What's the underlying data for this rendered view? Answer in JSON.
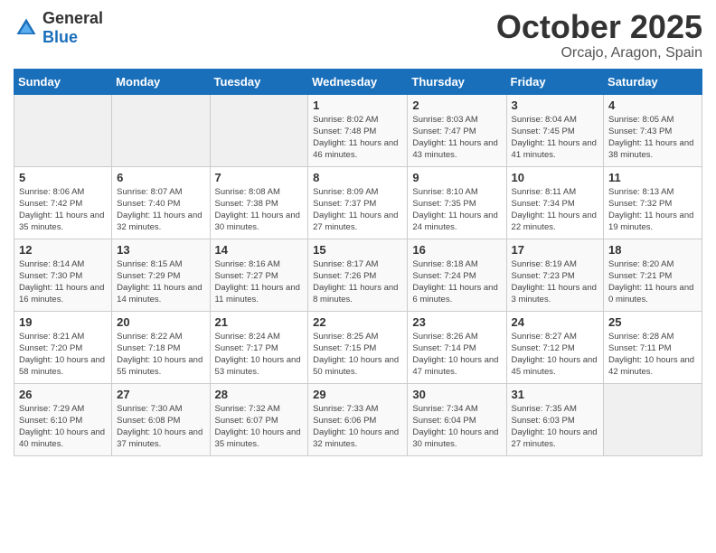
{
  "header": {
    "logo_general": "General",
    "logo_blue": "Blue",
    "month": "October 2025",
    "location": "Orcajo, Aragon, Spain"
  },
  "weekdays": [
    "Sunday",
    "Monday",
    "Tuesday",
    "Wednesday",
    "Thursday",
    "Friday",
    "Saturday"
  ],
  "weeks": [
    [
      {
        "day": "",
        "info": ""
      },
      {
        "day": "",
        "info": ""
      },
      {
        "day": "",
        "info": ""
      },
      {
        "day": "1",
        "info": "Sunrise: 8:02 AM\nSunset: 7:48 PM\nDaylight: 11 hours and 46 minutes."
      },
      {
        "day": "2",
        "info": "Sunrise: 8:03 AM\nSunset: 7:47 PM\nDaylight: 11 hours and 43 minutes."
      },
      {
        "day": "3",
        "info": "Sunrise: 8:04 AM\nSunset: 7:45 PM\nDaylight: 11 hours and 41 minutes."
      },
      {
        "day": "4",
        "info": "Sunrise: 8:05 AM\nSunset: 7:43 PM\nDaylight: 11 hours and 38 minutes."
      }
    ],
    [
      {
        "day": "5",
        "info": "Sunrise: 8:06 AM\nSunset: 7:42 PM\nDaylight: 11 hours and 35 minutes."
      },
      {
        "day": "6",
        "info": "Sunrise: 8:07 AM\nSunset: 7:40 PM\nDaylight: 11 hours and 32 minutes."
      },
      {
        "day": "7",
        "info": "Sunrise: 8:08 AM\nSunset: 7:38 PM\nDaylight: 11 hours and 30 minutes."
      },
      {
        "day": "8",
        "info": "Sunrise: 8:09 AM\nSunset: 7:37 PM\nDaylight: 11 hours and 27 minutes."
      },
      {
        "day": "9",
        "info": "Sunrise: 8:10 AM\nSunset: 7:35 PM\nDaylight: 11 hours and 24 minutes."
      },
      {
        "day": "10",
        "info": "Sunrise: 8:11 AM\nSunset: 7:34 PM\nDaylight: 11 hours and 22 minutes."
      },
      {
        "day": "11",
        "info": "Sunrise: 8:13 AM\nSunset: 7:32 PM\nDaylight: 11 hours and 19 minutes."
      }
    ],
    [
      {
        "day": "12",
        "info": "Sunrise: 8:14 AM\nSunset: 7:30 PM\nDaylight: 11 hours and 16 minutes."
      },
      {
        "day": "13",
        "info": "Sunrise: 8:15 AM\nSunset: 7:29 PM\nDaylight: 11 hours and 14 minutes."
      },
      {
        "day": "14",
        "info": "Sunrise: 8:16 AM\nSunset: 7:27 PM\nDaylight: 11 hours and 11 minutes."
      },
      {
        "day": "15",
        "info": "Sunrise: 8:17 AM\nSunset: 7:26 PM\nDaylight: 11 hours and 8 minutes."
      },
      {
        "day": "16",
        "info": "Sunrise: 8:18 AM\nSunset: 7:24 PM\nDaylight: 11 hours and 6 minutes."
      },
      {
        "day": "17",
        "info": "Sunrise: 8:19 AM\nSunset: 7:23 PM\nDaylight: 11 hours and 3 minutes."
      },
      {
        "day": "18",
        "info": "Sunrise: 8:20 AM\nSunset: 7:21 PM\nDaylight: 11 hours and 0 minutes."
      }
    ],
    [
      {
        "day": "19",
        "info": "Sunrise: 8:21 AM\nSunset: 7:20 PM\nDaylight: 10 hours and 58 minutes."
      },
      {
        "day": "20",
        "info": "Sunrise: 8:22 AM\nSunset: 7:18 PM\nDaylight: 10 hours and 55 minutes."
      },
      {
        "day": "21",
        "info": "Sunrise: 8:24 AM\nSunset: 7:17 PM\nDaylight: 10 hours and 53 minutes."
      },
      {
        "day": "22",
        "info": "Sunrise: 8:25 AM\nSunset: 7:15 PM\nDaylight: 10 hours and 50 minutes."
      },
      {
        "day": "23",
        "info": "Sunrise: 8:26 AM\nSunset: 7:14 PM\nDaylight: 10 hours and 47 minutes."
      },
      {
        "day": "24",
        "info": "Sunrise: 8:27 AM\nSunset: 7:12 PM\nDaylight: 10 hours and 45 minutes."
      },
      {
        "day": "25",
        "info": "Sunrise: 8:28 AM\nSunset: 7:11 PM\nDaylight: 10 hours and 42 minutes."
      }
    ],
    [
      {
        "day": "26",
        "info": "Sunrise: 7:29 AM\nSunset: 6:10 PM\nDaylight: 10 hours and 40 minutes."
      },
      {
        "day": "27",
        "info": "Sunrise: 7:30 AM\nSunset: 6:08 PM\nDaylight: 10 hours and 37 minutes."
      },
      {
        "day": "28",
        "info": "Sunrise: 7:32 AM\nSunset: 6:07 PM\nDaylight: 10 hours and 35 minutes."
      },
      {
        "day": "29",
        "info": "Sunrise: 7:33 AM\nSunset: 6:06 PM\nDaylight: 10 hours and 32 minutes."
      },
      {
        "day": "30",
        "info": "Sunrise: 7:34 AM\nSunset: 6:04 PM\nDaylight: 10 hours and 30 minutes."
      },
      {
        "day": "31",
        "info": "Sunrise: 7:35 AM\nSunset: 6:03 PM\nDaylight: 10 hours and 27 minutes."
      },
      {
        "day": "",
        "info": ""
      }
    ]
  ]
}
